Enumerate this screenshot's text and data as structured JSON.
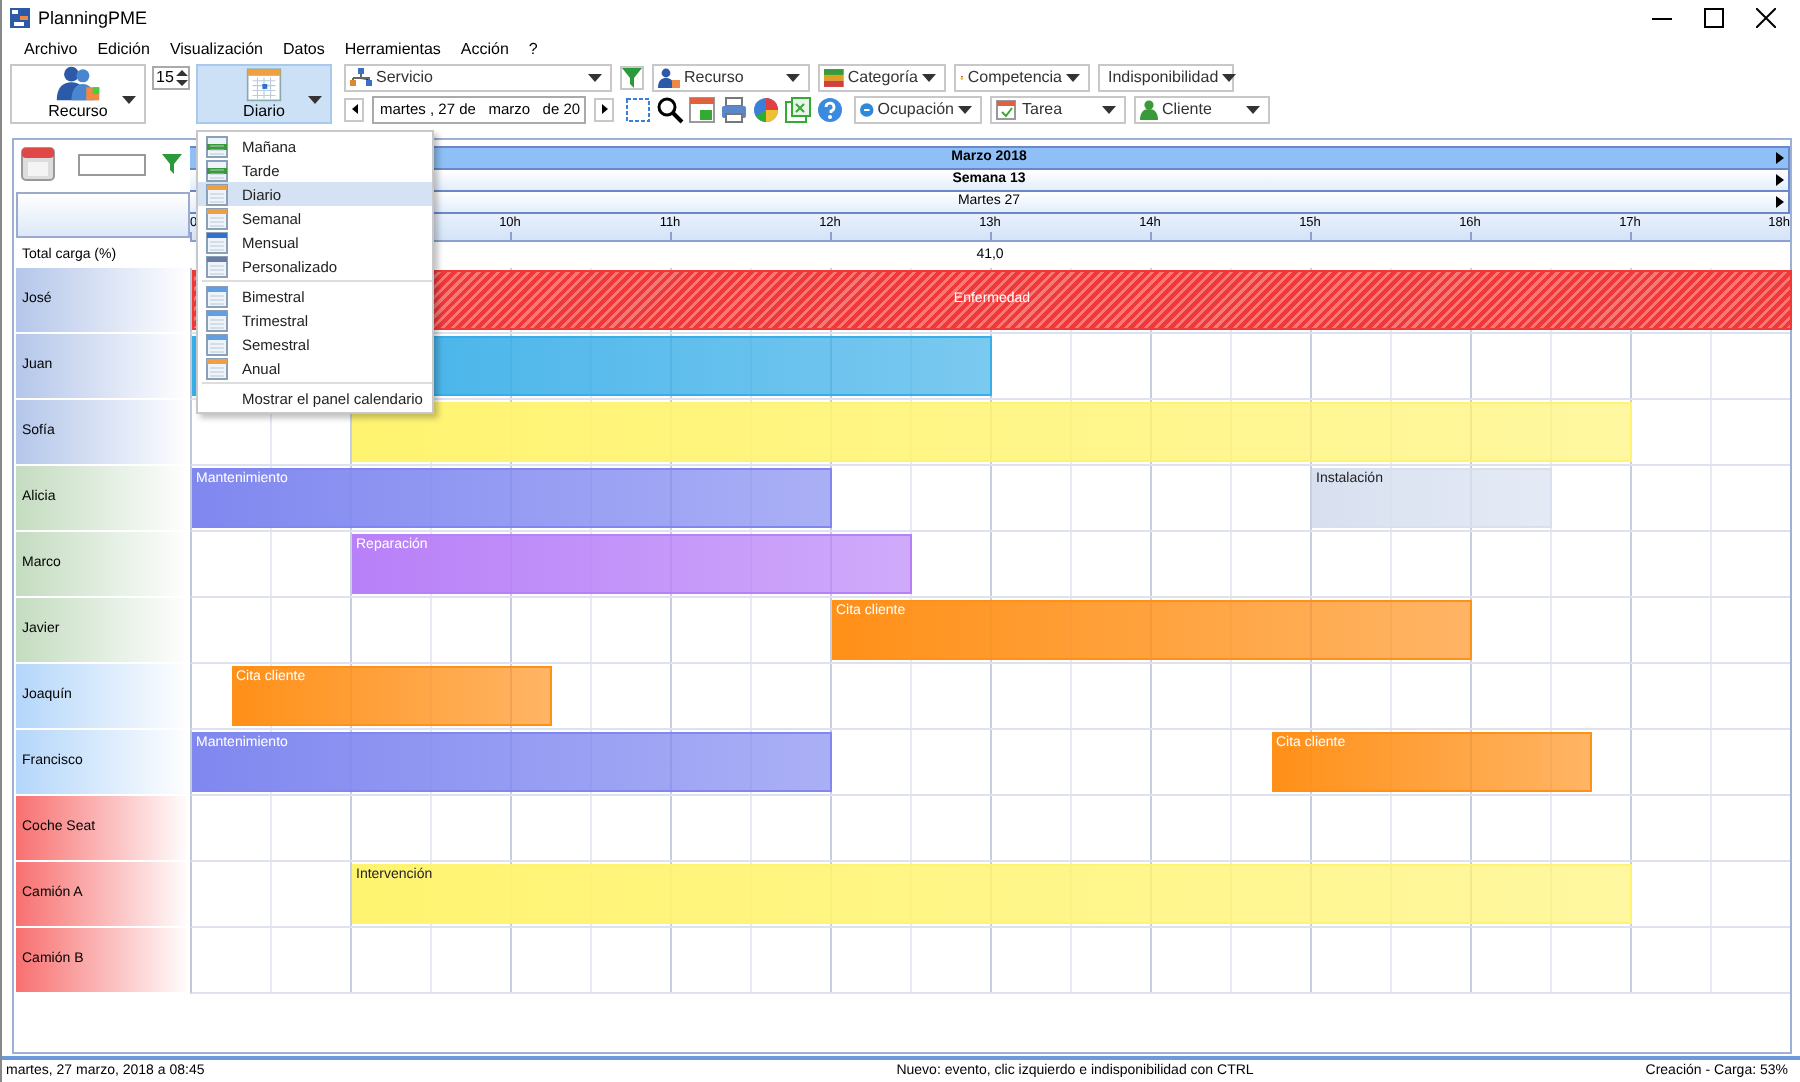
{
  "window": {
    "title": "PlanningPME"
  },
  "menu_bar": [
    "Archivo",
    "Edición",
    "Visualización",
    "Datos",
    "Herramientas",
    "Acción",
    "?"
  ],
  "toolbar": {
    "resource_button": "Recurso",
    "spin_value": "15",
    "view_button": {
      "label": "Diario",
      "selected": true
    },
    "filters_top": [
      {
        "label": "Servicio"
      },
      {
        "label": "Recurso"
      },
      {
        "label": "Categoría"
      },
      {
        "label": "Competencia"
      },
      {
        "label": "Indisponibilidad"
      }
    ],
    "date_field": "martes , 27 de   marzo   de 20",
    "filters_bottom": [
      {
        "label": "Ocupación"
      },
      {
        "label": "Tarea"
      },
      {
        "label": "Cliente"
      }
    ]
  },
  "view_menu": {
    "sections": [
      {
        "items": [
          {
            "label": "Mañana",
            "selected": false
          },
          {
            "label": "Tarde",
            "selected": false
          },
          {
            "label": "Diario",
            "selected": true
          },
          {
            "label": "Semanal",
            "selected": false
          },
          {
            "label": "Mensual",
            "selected": false
          },
          {
            "label": "Personalizado",
            "selected": false
          }
        ]
      },
      {
        "items": [
          {
            "label": "Bimestral",
            "selected": false
          },
          {
            "label": "Trimestral",
            "selected": false
          },
          {
            "label": "Semestral",
            "selected": false
          },
          {
            "label": "Anual",
            "selected": false
          }
        ]
      },
      {
        "items": [
          {
            "label": "Mostrar el panel calendario",
            "selected": false
          }
        ]
      }
    ]
  },
  "planning": {
    "month": "Marzo 2018",
    "week": "Semana 13",
    "day": "Martes 27",
    "hour_ticks": [
      "0",
      "10h",
      "11h",
      "12h",
      "13h",
      "14h",
      "15h",
      "16h",
      "17h",
      "18h"
    ],
    "total_label": "Total carga (%)",
    "total_value": "41,0",
    "resources": [
      {
        "name": "José",
        "color": "#b4c6ea",
        "events": [
          {
            "kind": "unavailability",
            "label": "Enfermedad",
            "color": "#f03838"
          }
        ]
      },
      {
        "name": "Juan",
        "color": "#b4c6ea",
        "events": [
          {
            "kind": "task",
            "color": "#38aee8"
          }
        ]
      },
      {
        "name": "Sofía",
        "color": "#b4c6ea",
        "events": [
          {
            "kind": "task",
            "color": "#fff470"
          }
        ]
      },
      {
        "name": "Alicia",
        "color": "#c4dcc0",
        "events": [
          {
            "kind": "task",
            "label": "Mantenimiento",
            "color": "#8088f0"
          },
          {
            "kind": "task",
            "label": "Instalación",
            "color": "#d8e0f0"
          }
        ]
      },
      {
        "name": "Marco",
        "color": "#c4dcc0",
        "events": [
          {
            "kind": "task",
            "label": "Reparación",
            "color": "#b880f8"
          }
        ]
      },
      {
        "name": "Javier",
        "color": "#c4dcc0",
        "events": [
          {
            "kind": "task",
            "label": "Cita cliente",
            "color": "#ff9018"
          }
        ]
      },
      {
        "name": "Joaquín",
        "color": "#b4d6fa",
        "events": [
          {
            "kind": "task",
            "label": "Cita cliente",
            "color": "#ff9018"
          }
        ]
      },
      {
        "name": "Francisco",
        "color": "#b4d6fa",
        "events": [
          {
            "kind": "task",
            "label": "Mantenimiento",
            "color": "#8088f0"
          },
          {
            "kind": "task",
            "label": "Cita cliente",
            "color": "#ff9018"
          }
        ]
      },
      {
        "name": "Coche Seat",
        "color": "#f87070"
      },
      {
        "name": "Camión A",
        "color": "#f87070",
        "events": [
          {
            "kind": "task",
            "label": "Intervención",
            "color": "#fff470"
          }
        ]
      },
      {
        "name": "Camión B",
        "color": "#f87070"
      }
    ]
  },
  "status_bar": {
    "left": "martes, 27 marzo, 2018 a 08:45",
    "center": "Nuevo: evento, clic izquierdo e indisponibilidad con CTRL",
    "right": "Creación - Carga: 53%"
  }
}
